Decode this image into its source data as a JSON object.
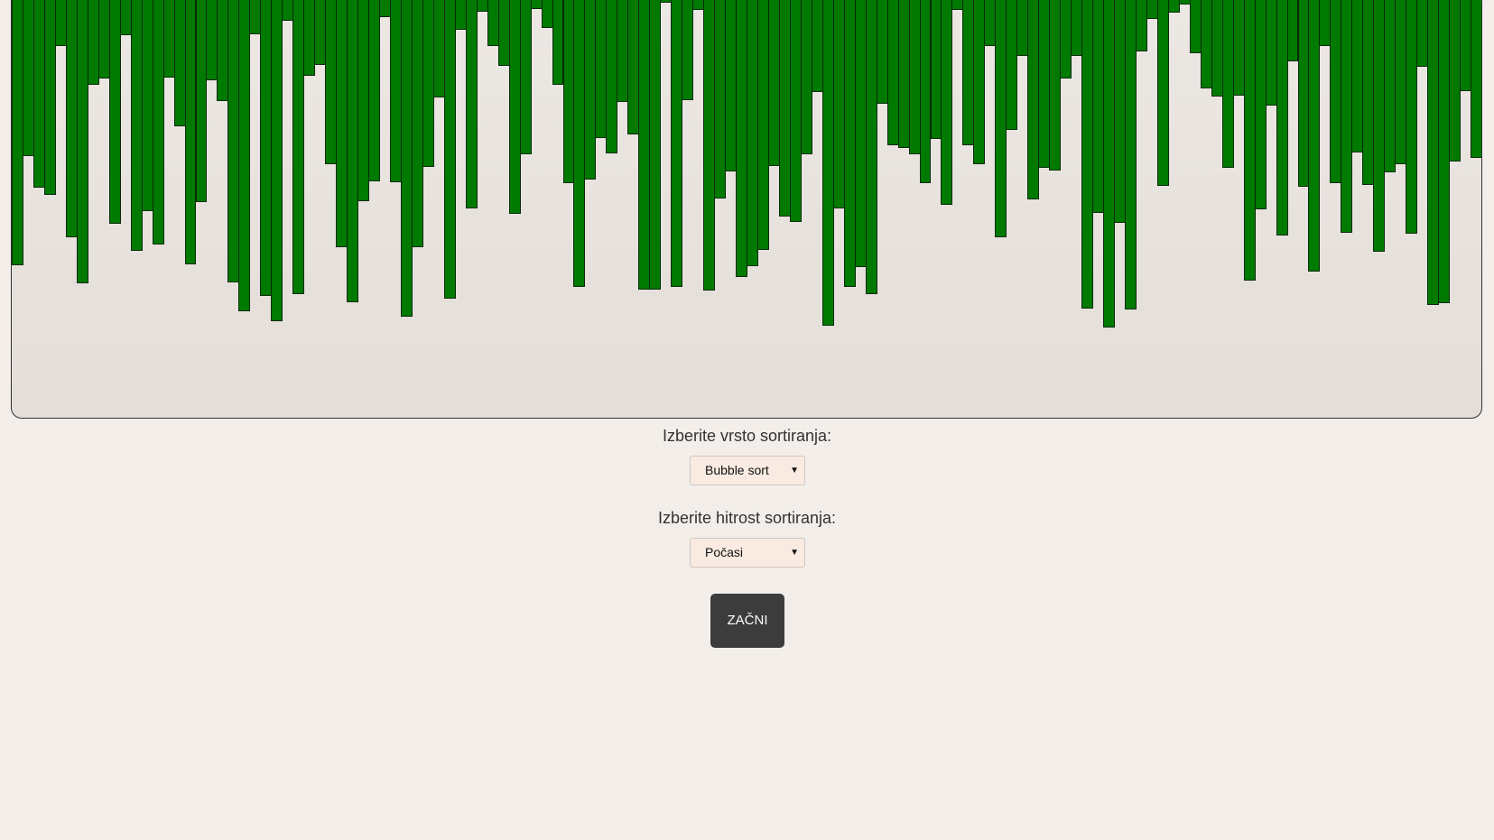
{
  "visualization": {
    "bar_color": "#007a00",
    "values": [
      293,
      172,
      207,
      215,
      50,
      262,
      313,
      93,
      86,
      247,
      38,
      277,
      233,
      270,
      85,
      139,
      292,
      223,
      88,
      111,
      312,
      344,
      37,
      327,
      355,
      22,
      325,
      83,
      71,
      181,
      273,
      334,
      222,
      200,
      18,
      201,
      350,
      273,
      184,
      107,
      330,
      32,
      230,
      12,
      50,
      72,
      236,
      170,
      9,
      30,
      93,
      202,
      317,
      198,
      152,
      169,
      112,
      148,
      320,
      320,
      2,
      317,
      110,
      10,
      321,
      219,
      189,
      306,
      294,
      276,
      183,
      239,
      245,
      170,
      101,
      360,
      230,
      317,
      295,
      325,
      114,
      160,
      163,
      170,
      202,
      153,
      226,
      10,
      160,
      181,
      50,
      262,
      143,
      61,
      220,
      185,
      188,
      86,
      61,
      341,
      235,
      362,
      246,
      342,
      56,
      20,
      205,
      13,
      4,
      58,
      97,
      106,
      185,
      105,
      310,
      231,
      116,
      260,
      67,
      206,
      300,
      50,
      202,
      257,
      168,
      204,
      278,
      190,
      181,
      258,
      73,
      337,
      335,
      178,
      100,
      174
    ]
  },
  "controls": {
    "sort_type_label": "Izberite vrsto sortiranja:",
    "sort_type_value": "Bubble sort",
    "speed_label": "Izberite hitrost sortiranja:",
    "speed_value": "Počasi",
    "start_label": "ZAČNI"
  },
  "icons": {
    "dropdown": "triangle-down-icon"
  }
}
